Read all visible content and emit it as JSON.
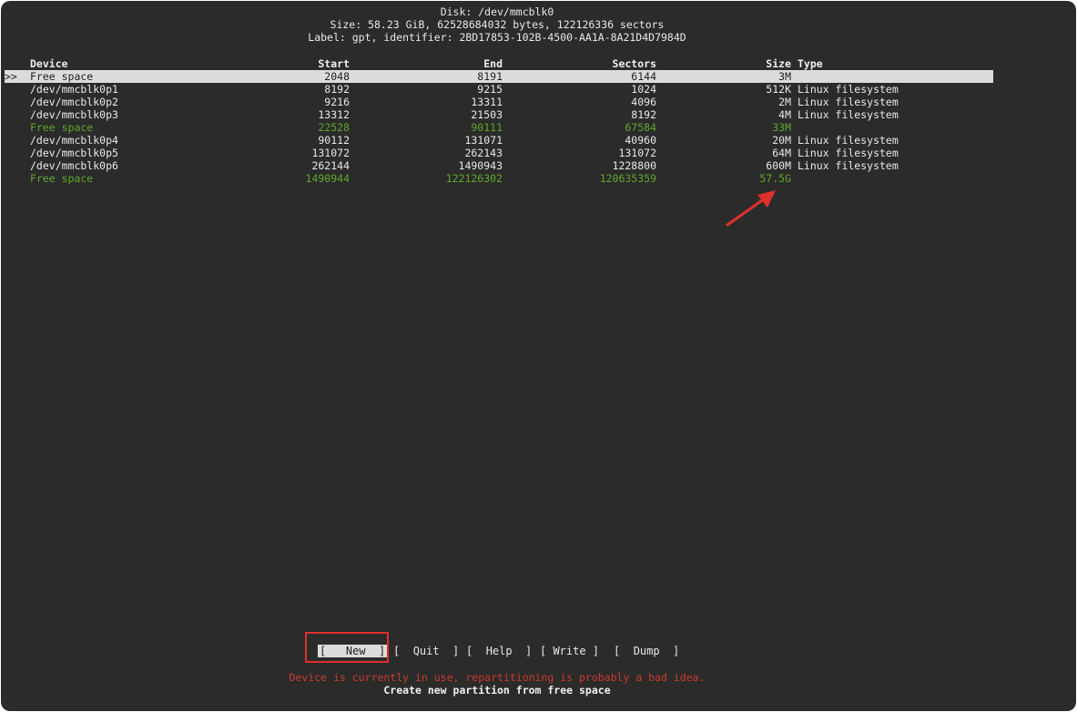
{
  "header": {
    "disk": "Disk: /dev/mmcblk0",
    "size": "Size: 58.23 GiB, 62528684032 bytes, 122126336 sectors",
    "label": "Label: gpt, identifier: 2BD17853-102B-4500-AA1A-8A21D4D7984D"
  },
  "columns": {
    "device": "Device",
    "start": "Start",
    "end": "End",
    "sectors": "Sectors",
    "size": "Size",
    "type": "Type"
  },
  "rows": [
    {
      "marker": ">>",
      "device": "Free space",
      "start": "2048",
      "end": "8191",
      "sectors": "6144",
      "size": "3M",
      "type": ""
    },
    {
      "marker": "",
      "device": "/dev/mmcblk0p1",
      "start": "8192",
      "end": "9215",
      "sectors": "1024",
      "size": "512K",
      "type": "Linux filesystem"
    },
    {
      "marker": "",
      "device": "/dev/mmcblk0p2",
      "start": "9216",
      "end": "13311",
      "sectors": "4096",
      "size": "2M",
      "type": "Linux filesystem"
    },
    {
      "marker": "",
      "device": "/dev/mmcblk0p3",
      "start": "13312",
      "end": "21503",
      "sectors": "8192",
      "size": "4M",
      "type": "Linux filesystem"
    },
    {
      "marker": "",
      "device": "Free space",
      "start": "22528",
      "end": "90111",
      "sectors": "67584",
      "size": "33M",
      "type": ""
    },
    {
      "marker": "",
      "device": "/dev/mmcblk0p4",
      "start": "90112",
      "end": "131071",
      "sectors": "40960",
      "size": "20M",
      "type": "Linux filesystem"
    },
    {
      "marker": "",
      "device": "/dev/mmcblk0p5",
      "start": "131072",
      "end": "262143",
      "sectors": "131072",
      "size": "64M",
      "type": "Linux filesystem"
    },
    {
      "marker": "",
      "device": "/dev/mmcblk0p6",
      "start": "262144",
      "end": "1490943",
      "sectors": "1228800",
      "size": "600M",
      "type": "Linux filesystem"
    },
    {
      "marker": "",
      "device": "Free space",
      "start": "1490944",
      "end": "122126302",
      "sectors": "120635359",
      "size": "57.5G",
      "type": ""
    }
  ],
  "menu": {
    "new": "New",
    "quit": "Quit",
    "help": "Help",
    "write": "Write",
    "dump": "Dump"
  },
  "status": {
    "warning": "Device is currently in use, repartitioning is probably a bad idea.",
    "hint": "Create new partition from free space"
  },
  "colors": {
    "background": "#2b2b2b",
    "free_space": "#5fa82a",
    "selected_bg": "#dcdcdc",
    "warning": "#cc3a2e",
    "annotation": "#e0302a"
  },
  "icons": {
    "annotation_arrow": "red-arrow-icon"
  }
}
